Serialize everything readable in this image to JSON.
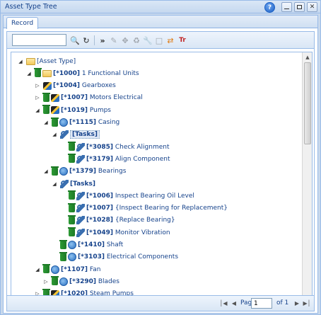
{
  "window": {
    "title": "Asset Type Tree"
  },
  "tabs": [
    {
      "label": "Record"
    }
  ],
  "toolbar": {
    "search_value": "",
    "buttons": [
      "search-icon",
      "refresh-icon",
      "expand-all-icon",
      "add-icon",
      "move-icon",
      "copy-icon",
      "edit-icon",
      "blank-icon",
      "sync-icon",
      "text-icon"
    ]
  },
  "tree": [
    {
      "code": "",
      "label": "[Asset Type]",
      "depth": 0,
      "icon": "folder",
      "expanded": true,
      "hasChildren": true
    },
    {
      "code": "[*1000]",
      "label": " 1 Functional Units",
      "depth": 1,
      "icon": "trash-folder",
      "expanded": true,
      "hasChildren": true
    },
    {
      "code": "[*1004]",
      "label": " Gearboxes",
      "depth": 2,
      "icon": "gear",
      "expanded": false,
      "hasChildren": true
    },
    {
      "code": "[*1007]",
      "label": " Motors Electrical",
      "depth": 2,
      "icon": "trash-gear",
      "expanded": false,
      "hasChildren": true
    },
    {
      "code": "[*1019]",
      "label": " Pumps",
      "depth": 2,
      "icon": "trash-gear",
      "expanded": true,
      "hasChildren": true
    },
    {
      "code": "[*1115]",
      "label": " Casing",
      "depth": 3,
      "icon": "trash-part",
      "expanded": true,
      "hasChildren": true
    },
    {
      "code": "[Tasks]",
      "label": "",
      "depth": 4,
      "icon": "wrench",
      "expanded": true,
      "hasChildren": true,
      "selected": true
    },
    {
      "code": "[*3085]",
      "label": " Check Alignment",
      "depth": 5,
      "icon": "trash-wrench",
      "expanded": false,
      "hasChildren": false
    },
    {
      "code": "[*3179]",
      "label": " Align Component",
      "depth": 5,
      "icon": "trash-wrench",
      "expanded": false,
      "hasChildren": false
    },
    {
      "code": "[*1379]",
      "label": " Bearings",
      "depth": 3,
      "icon": "trash-part",
      "expanded": true,
      "hasChildren": true
    },
    {
      "code": "[Tasks]",
      "label": "",
      "depth": 4,
      "icon": "wrench",
      "expanded": true,
      "hasChildren": true
    },
    {
      "code": "[*1006]",
      "label": " Inspect Bearing Oil Level",
      "depth": 5,
      "icon": "trash-wrench",
      "expanded": false,
      "hasChildren": false
    },
    {
      "code": "[*1007]",
      "label": " {Inspect Bearing for Replacement}",
      "depth": 5,
      "icon": "trash-wrench",
      "expanded": false,
      "hasChildren": false
    },
    {
      "code": "[*1028]",
      "label": " {Replace Bearing}",
      "depth": 5,
      "icon": "trash-wrench",
      "expanded": false,
      "hasChildren": false
    },
    {
      "code": "[*1049]",
      "label": " Monitor Vibration",
      "depth": 5,
      "icon": "trash-wrench",
      "expanded": false,
      "hasChildren": false
    },
    {
      "code": "[*1410]",
      "label": " Shaft",
      "depth": 4,
      "icon": "trash-part",
      "expanded": false,
      "hasChildren": false
    },
    {
      "code": "[*3103]",
      "label": " Electrical Components",
      "depth": 4,
      "icon": "trash-part",
      "expanded": false,
      "hasChildren": false
    },
    {
      "code": "[*1107]",
      "label": " Fan",
      "depth": 2,
      "icon": "trash-part",
      "expanded": true,
      "hasChildren": true
    },
    {
      "code": "[*3290]",
      "label": " Blades",
      "depth": 3,
      "icon": "trash-part",
      "expanded": false,
      "hasChildren": true
    },
    {
      "code": "[*1020]",
      "label": " Steam Pumps",
      "depth": 2,
      "icon": "trash-gear",
      "expanded": false,
      "hasChildren": true
    }
  ],
  "pager": {
    "page_label": "Page",
    "page_value": "1",
    "of_label": "of 1"
  }
}
